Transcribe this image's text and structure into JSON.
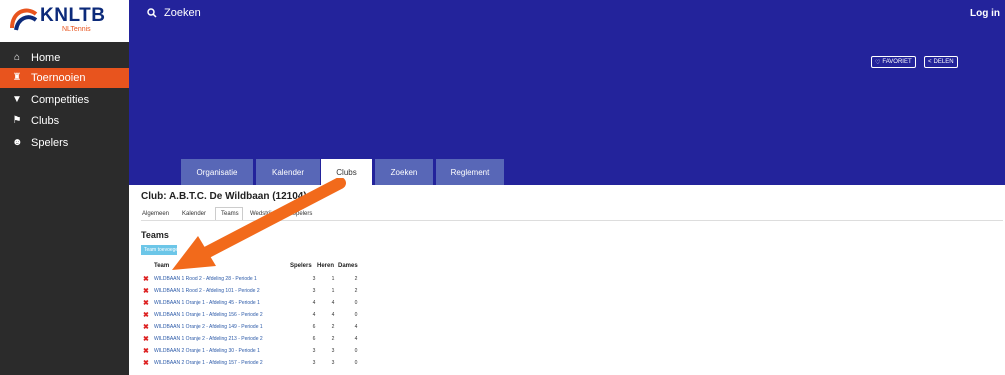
{
  "brand": {
    "name": "KNLTB",
    "sub": "NLTennis"
  },
  "sidebar": {
    "items": [
      {
        "label": "Home",
        "icon": "home-icon",
        "glyph": "⌂",
        "active": false
      },
      {
        "label": "Toernooien",
        "icon": "trophy-icon",
        "glyph": "🏆",
        "active": true
      },
      {
        "label": "Competities",
        "icon": "cup-icon",
        "glyph": "▼",
        "active": false
      },
      {
        "label": "Clubs",
        "icon": "flag-icon",
        "glyph": "⚑",
        "active": false
      },
      {
        "label": "Spelers",
        "icon": "users-icon",
        "glyph": "👥",
        "active": false
      }
    ]
  },
  "header": {
    "search_label": "Zoeken",
    "login_label": "Log in",
    "favoriet": "FAVORIET",
    "delen": "DELEN"
  },
  "tabs": [
    {
      "label": "Organisatie",
      "active": false
    },
    {
      "label": "Kalender",
      "active": false
    },
    {
      "label": "Clubs",
      "active": true
    },
    {
      "label": "Zoeken",
      "active": false
    },
    {
      "label": "Reglement",
      "active": false
    }
  ],
  "club": {
    "title": "Club: A.B.T.C. De Wildbaan (12104)",
    "subtabs": [
      "Algemeen",
      "Kalender",
      "Teams",
      "Wedstrijden",
      "Spelers"
    ],
    "teams_heading": "Teams",
    "team_button": "Team toevoegen"
  },
  "table": {
    "headers": [
      "Team",
      "Spelers",
      "Heren",
      "Dames"
    ],
    "rows": [
      {
        "name": "WILDBAAN 1  Rood 2 - Afdeling 28 - Periode 1",
        "spelers": "3",
        "heren": "1",
        "dames": "2"
      },
      {
        "name": "WILDBAAN 1  Rood 2 - Afdeling 101 - Periode 2",
        "spelers": "3",
        "heren": "1",
        "dames": "2"
      },
      {
        "name": "WILDBAAN 1  Oranje 1 - Afdeling 45 - Periode 1",
        "spelers": "4",
        "heren": "4",
        "dames": "0"
      },
      {
        "name": "WILDBAAN 1  Oranje 1 - Afdeling 156 - Periode 2",
        "spelers": "4",
        "heren": "4",
        "dames": "0"
      },
      {
        "name": "WILDBAAN 1  Oranje 2 - Afdeling 149 - Periode 1",
        "spelers": "6",
        "heren": "2",
        "dames": "4"
      },
      {
        "name": "WILDBAAN 1  Oranje 2 - Afdeling 213 - Periode 2",
        "spelers": "6",
        "heren": "2",
        "dames": "4"
      },
      {
        "name": "WILDBAAN 2  Oranje 1 - Afdeling 30 - Periode 1",
        "spelers": "3",
        "heren": "3",
        "dames": "0"
      },
      {
        "name": "WILDBAAN 2  Oranje 1 - Afdeling 157 - Periode 2",
        "spelers": "3",
        "heren": "3",
        "dames": "0"
      }
    ]
  },
  "colors": {
    "banner": "#23239b",
    "accent": "#e8541e",
    "tab": "#5867b7"
  }
}
